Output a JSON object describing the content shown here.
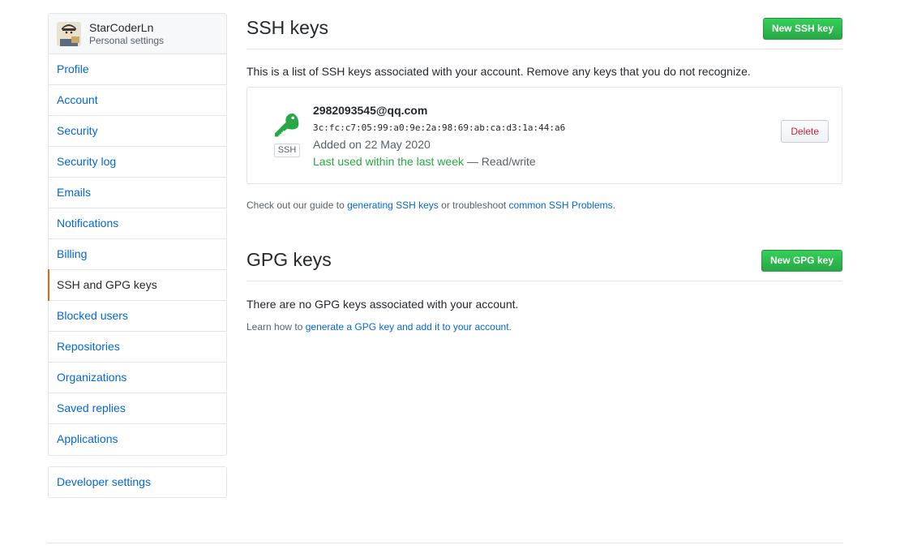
{
  "user": {
    "name": "StarCoderLn",
    "subtitle": "Personal settings"
  },
  "sidebar": {
    "items": [
      {
        "label": "Profile"
      },
      {
        "label": "Account"
      },
      {
        "label": "Security"
      },
      {
        "label": "Security log"
      },
      {
        "label": "Emails"
      },
      {
        "label": "Notifications"
      },
      {
        "label": "Billing"
      },
      {
        "label": "SSH and GPG keys",
        "selected": true
      },
      {
        "label": "Blocked users"
      },
      {
        "label": "Repositories"
      },
      {
        "label": "Organizations"
      },
      {
        "label": "Saved replies"
      },
      {
        "label": "Applications"
      }
    ],
    "developer": "Developer settings",
    "selected_color": "#e36209"
  },
  "ssh": {
    "title": "SSH keys",
    "new_button": "New SSH key",
    "description": "This is a list of SSH keys associated with your account. Remove any keys that you do not recognize.",
    "key": {
      "icon": "key-icon",
      "type_label": "SSH",
      "title": "2982093545@qq.com",
      "fingerprint": "3c:fc:c7:05:99:a0:9e:2a:98:69:ab:ca:d3:1a:44:a6",
      "added": "Added on 22 May 2020",
      "last_used": "Last used within the last week",
      "access": " — Read/write",
      "delete_label": "Delete"
    },
    "note_prefix": "Check out our guide to ",
    "note_link1": "generating SSH keys",
    "note_middle": " or troubleshoot ",
    "note_link2": "common SSH Problems",
    "note_suffix": "."
  },
  "gpg": {
    "title": "GPG keys",
    "new_button": "New GPG key",
    "empty": "There are no GPG keys associated with your account.",
    "note_prefix": "Learn how to ",
    "note_link": "generate a GPG key and add it to your account",
    "note_suffix": "."
  },
  "colors": {
    "link": "#0366d6",
    "green": "#28a745",
    "danger": "#cb2431",
    "border": "#e1e4e8"
  }
}
